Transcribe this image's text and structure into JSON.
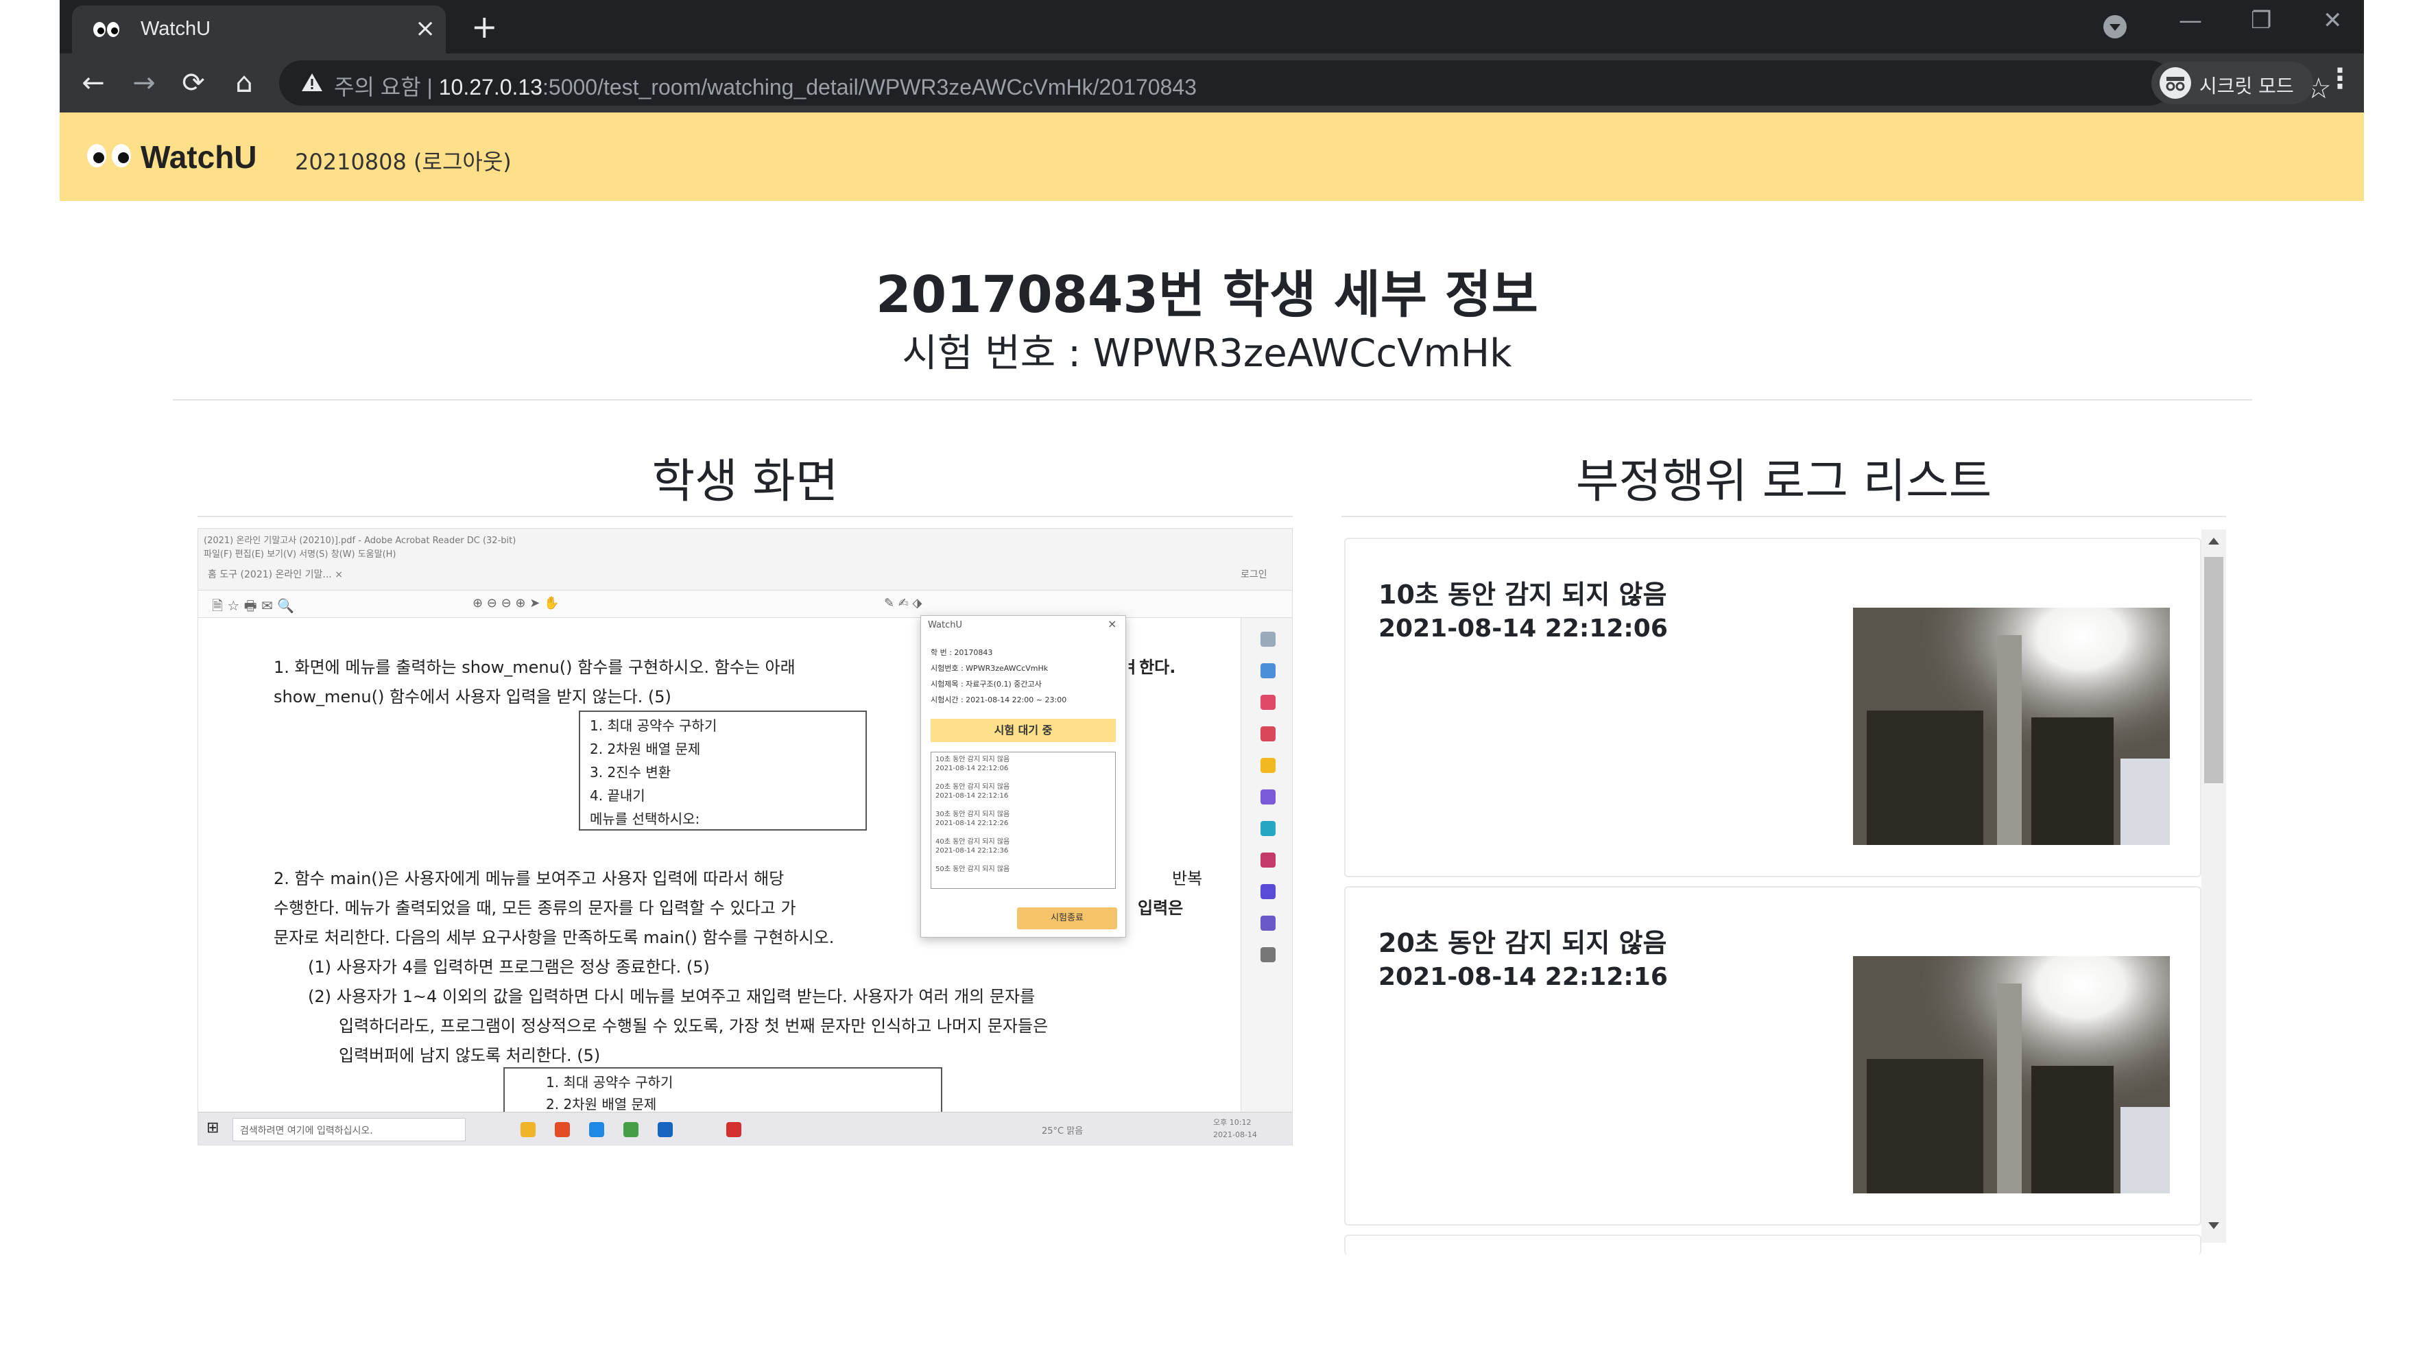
{
  "browser": {
    "tab_title": "WatchU",
    "url_warning": "주의 요함",
    "url_host": "10.27.0.13",
    "url_path": ":5000/test_room/watching_detail/WPWR3zeAWCcVmHk/20170843",
    "incognito_label": "시크릿 모드"
  },
  "navbar": {
    "brand": "WatchU",
    "user": "20210808 (로그아웃)"
  },
  "page": {
    "title": "20170843번 학생 세부 정보",
    "exam_number": "시험 번호 : WPWR3zeAWCcVmHk"
  },
  "student_screen": {
    "title": "학생 화면",
    "window_title": "(2021) 온라인 기말고사 (20210)].pdf - Adobe Acrobat Reader DC (32-bit)",
    "menu": "파일(F)  편집(E)  보기(V)  서명(S)  창(W)  도움말(H)",
    "acro_tabs": "홈   도구     (2021) 온라인 기말...  ×",
    "login": "로그인",
    "doc_lines": [
      "1. 화면에 메뉴를 출력하는 show_menu() 함수를 구현하시오. 함수는 아래",
      "show_menu() 함수에서 사용자 입력을 받지 않는다. (5)",
      "2. 함수 main()은 사용자에게 메뉴를 보여주고 사용자 입력에 따라서 해당",
      "수행한다. 메뉴가 출력되었을 때, 모든 종류의 문자를 다 입력할 수 있다고 가",
      "문자로 처리한다. 다음의 세부 요구사항을 만족하도록 main() 함수를 구현하시오.",
      "(1) 사용자가 4를 입력하면 프로그램은 정상 종료한다. (5)",
      "(2) 사용자가 1~4 이외의 값을 입력하면 다시 메뉴를 보여주고 재입력 받는다. 사용자가 여러 개의 문자를",
      "입력하더라도, 프로그램이 정상적으로 수행될 수 있도록, 가장 첫 번째 문자만 인식하고 나머지 문자들은",
      "입력버퍼에 남지 않도록 처리한다. (5)"
    ],
    "doc_right_fragments": [
      "ㅕ한다.",
      "반복",
      "입력은"
    ],
    "menu_box": [
      "1. 최대 공약수 구하기",
      "2. 2차원 배열 문제",
      "3. 2진수 변환",
      "4. 끝내기",
      "메뉴를 선택하시오:"
    ],
    "menu_box2": [
      "1. 최대 공약수 구하기",
      "2. 2차원 배열 문제"
    ],
    "popup": {
      "title": "WatchU",
      "info": [
        "학    번 :  20170843",
        "시험번호 :  WPWR3zeAWCcVmHk",
        "시험제목 :  자료구조(0.1) 중간고사",
        "시험시간 :  2021-08-14 22:00 ~ 23:00"
      ],
      "status": "시험 대기 중",
      "items": [
        "10초 동안 감지 되지 않음",
        "2021-08-14 22:12:06",
        "20초 동안 감지 되지 않음",
        "2021-08-14 22:12:16",
        "30초 동안 감지 되지 않음",
        "2021-08-14 22:12:26",
        "40초 동안 감지 되지 않음",
        "2021-08-14 22:12:36",
        "50초 동안 감지 되지 않음"
      ],
      "end_button": "시험종료"
    },
    "taskbar": {
      "search": "검색하려면 여기에 입력하십시오.",
      "weather": "25°C 맑음",
      "clock": "오후 10:12\n2021-08-14"
    }
  },
  "log_list": {
    "title": "부정행위 로그 리스트",
    "items": [
      {
        "message": "10초 동안 감지 되지 않음",
        "time": "2021-08-14 22:12:06"
      },
      {
        "message": "20초 동안 감지 되지 않음",
        "time": "2021-08-14 22:12:16"
      }
    ]
  }
}
